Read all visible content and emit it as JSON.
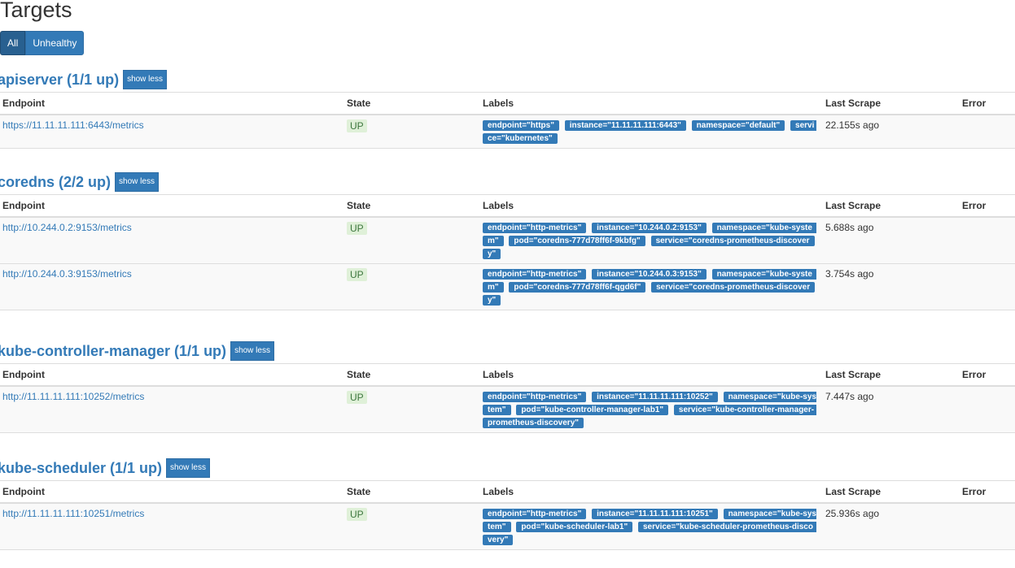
{
  "page": {
    "title": "Targets",
    "filters": [
      "All",
      "Unhealthy"
    ],
    "columns": {
      "endpoint": "Endpoint",
      "state": "State",
      "labels": "Labels",
      "last_scrape": "Last Scrape",
      "error": "Error"
    },
    "toggle_label": "show less"
  },
  "jobs": [
    {
      "title": "apiserver (1/1 up)",
      "targets": [
        {
          "endpoint": "https://11.11.11.111:6443/metrics",
          "state": "UP",
          "labels": [
            "endpoint=\"https\"",
            "instance=\"11.11.11.111:6443\"",
            "namespace=\"default\"",
            "service=\"kubernetes\""
          ],
          "last_scrape": "22.155s ago",
          "error": ""
        }
      ]
    },
    {
      "title": "coredns (2/2 up)",
      "targets": [
        {
          "endpoint": "http://10.244.0.2:9153/metrics",
          "state": "UP",
          "labels": [
            "endpoint=\"http-metrics\"",
            "instance=\"10.244.0.2:9153\"",
            "namespace=\"kube-system\"",
            "pod=\"coredns-777d78ff6f-9kbfg\"",
            "service=\"coredns-prometheus-discovery\""
          ],
          "last_scrape": "5.688s ago",
          "error": ""
        },
        {
          "endpoint": "http://10.244.0.3:9153/metrics",
          "state": "UP",
          "labels": [
            "endpoint=\"http-metrics\"",
            "instance=\"10.244.0.3:9153\"",
            "namespace=\"kube-system\"",
            "pod=\"coredns-777d78ff6f-qgd6f\"",
            "service=\"coredns-prometheus-discovery\""
          ],
          "last_scrape": "3.754s ago",
          "error": ""
        }
      ]
    },
    {
      "title": "kube-controller-manager (1/1 up)",
      "targets": [
        {
          "endpoint": "http://11.11.11.111:10252/metrics",
          "state": "UP",
          "labels": [
            "endpoint=\"http-metrics\"",
            "instance=\"11.11.11.111:10252\"",
            "namespace=\"kube-system\"",
            "pod=\"kube-controller-manager-lab1\"",
            "service=\"kube-controller-manager-prometheus-discovery\""
          ],
          "last_scrape": "7.447s ago",
          "error": ""
        }
      ]
    },
    {
      "title": "kube-scheduler (1/1 up)",
      "targets": [
        {
          "endpoint": "http://11.11.11.111:10251/metrics",
          "state": "UP",
          "labels": [
            "endpoint=\"http-metrics\"",
            "instance=\"11.11.11.111:10251\"",
            "namespace=\"kube-system\"",
            "pod=\"kube-scheduler-lab1\"",
            "service=\"kube-scheduler-prometheus-discovery\""
          ],
          "last_scrape": "25.936s ago",
          "error": ""
        }
      ]
    }
  ]
}
